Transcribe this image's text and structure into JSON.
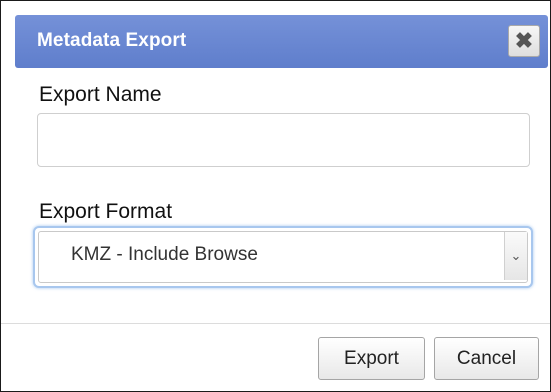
{
  "dialog": {
    "title": "Metadata Export",
    "close_icon": "close-icon",
    "close_glyph": "✖"
  },
  "form": {
    "name_label": "Export Name",
    "name_value": "",
    "format_label": "Export Format",
    "format_selected": "KMZ - Include Browse",
    "dropdown_icon": "chevron-down-icon",
    "dropdown_glyph": "⌄"
  },
  "footer": {
    "export_label": "Export",
    "cancel_label": "Cancel"
  },
  "colors": {
    "titlebar": "#6a87d2",
    "title_text": "#ffffff",
    "focus_ring": "#a8c7ee"
  }
}
